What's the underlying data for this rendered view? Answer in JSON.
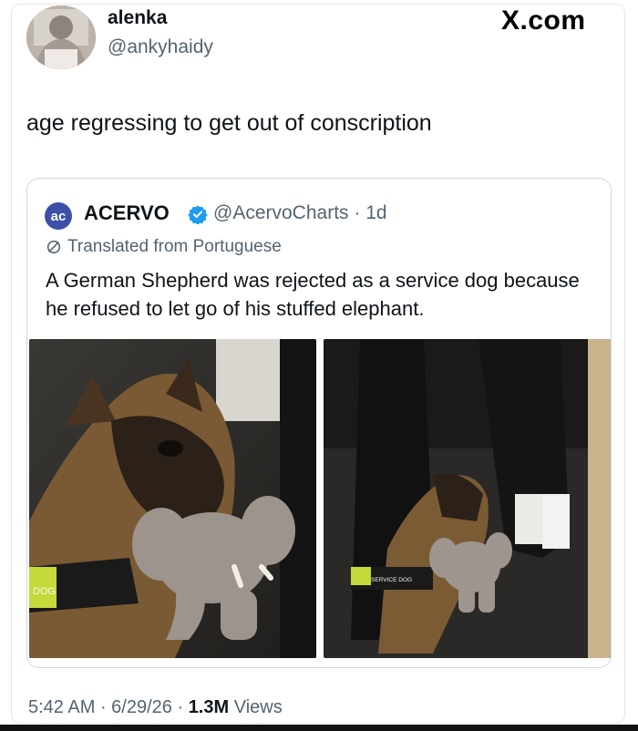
{
  "post": {
    "display_name": "alenka",
    "handle": "@ankyhaidy",
    "site_logo": "X.com",
    "text": "age regressing to get out of conscription"
  },
  "quoted": {
    "avatar_text": "ac",
    "name": "ACERVO",
    "handle_time": "@AcervoCharts · 1d",
    "translated_label": "Translated from Portuguese",
    "text": "A German Shepherd was rejected as a service dog because he refused to let go of his stuffed elephant.",
    "vest_label_left": "DOG",
    "vest_label_right": "SERVICE DOG"
  },
  "footer": {
    "time": "5:42 AM",
    "sep1": " · ",
    "date": "6/29/26",
    "sep2": " · ",
    "views_count": "1.3M",
    "views_label": " Views"
  },
  "colors": {
    "verified": "#1d9bf0",
    "secondary_text": "#536471",
    "border": "#cfd9de"
  }
}
